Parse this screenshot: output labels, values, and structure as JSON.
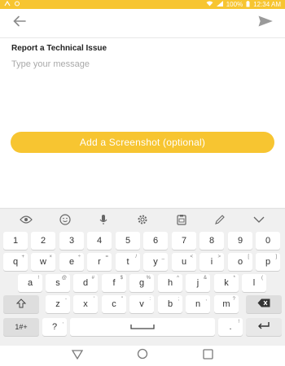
{
  "status": {
    "battery": "100%",
    "time": "12:34 AM"
  },
  "appbar": {
    "back_icon": "arrow-left-icon",
    "send_icon": "send-icon"
  },
  "form": {
    "title": "Report a Technical Issue",
    "message_placeholder": "Type your message",
    "message_value": "",
    "screenshot_button_label": "Add a Screenshot (optional)"
  },
  "keyboard": {
    "toolbar_icons": [
      "sticker-face-icon",
      "emoji-icon",
      "microphone-icon",
      "gear-icon",
      "clipboard-icon",
      "pen-icon",
      "chevron-down-icon"
    ],
    "rows": {
      "numbers": [
        "1",
        "2",
        "3",
        "4",
        "5",
        "6",
        "7",
        "8",
        "9",
        "0"
      ],
      "top_letters": [
        "q",
        "w",
        "e",
        "r",
        "t",
        "y",
        "u",
        "i",
        "o",
        "p"
      ],
      "top_letters_sup": [
        "+",
        "×",
        "÷",
        "=",
        "/",
        "_",
        "<",
        ">",
        "[",
        "]"
      ],
      "mid_letters": [
        "a",
        "s",
        "d",
        "f",
        "g",
        "h",
        "j",
        "k",
        "l"
      ],
      "mid_letters_sup": [
        "!",
        "@",
        "#",
        "$",
        "%",
        "^",
        "&",
        "*",
        "("
      ],
      "bottom_letters": [
        "z",
        "x",
        "c",
        "v",
        "b",
        "n",
        "m"
      ],
      "bottom_letters_sup": [
        "-",
        "'",
        "\"",
        ":",
        ";",
        ",",
        "?"
      ],
      "symbols_key": "1#+",
      "question_key": "?",
      "question_sup": ",",
      "space_label": "",
      "period_key": ".",
      "period_sup": "!"
    }
  },
  "colors": {
    "accent": "#f7c531"
  }
}
